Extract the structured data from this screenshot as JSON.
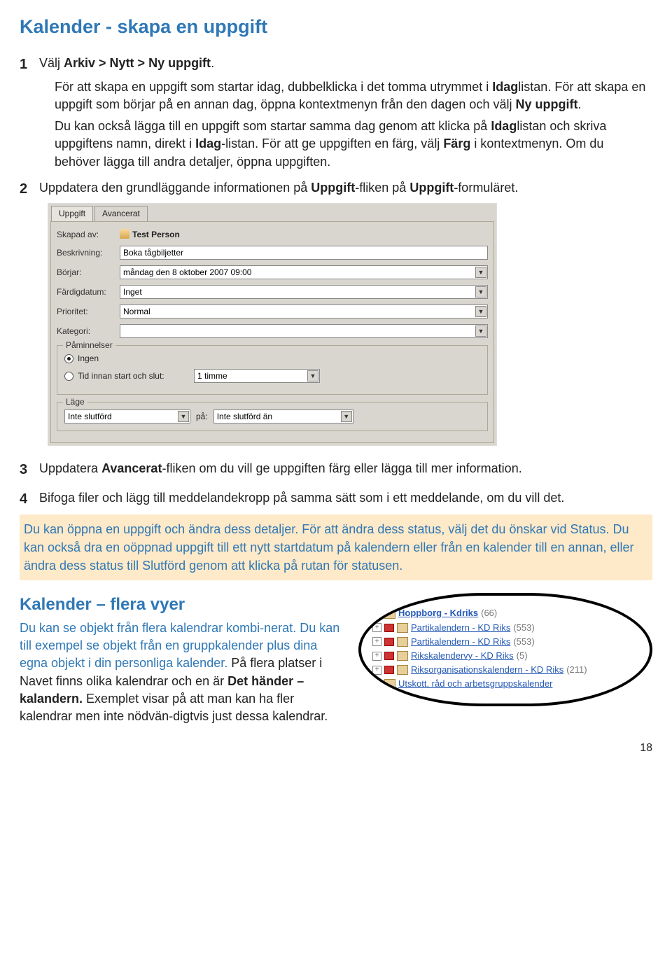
{
  "title": "Kalender - skapa en uppgift",
  "step1": {
    "num": "1",
    "lead": "Välj ",
    "bold": "Arkiv > Nytt > Ny uppgift",
    "tail": ".",
    "p1a": "För att skapa en uppgift som startar idag, dubbelklicka i det tomma utrymmet i ",
    "p1b": "Idag",
    "p1c": "listan. För att skapa en uppgift som börjar på en annan dag, öppna kontextmenyn från den dagen och välj ",
    "p1d": "Ny uppgift",
    "p1e": ".",
    "p2a": "Du kan också lägga till en uppgift som startar samma dag genom att klicka på ",
    "p2b": "Idag",
    "p2c": "listan och skriva uppgiftens namn, direkt i ",
    "p2d": "Idag",
    "p2e": "-listan. För att ge uppgiften en färg, välj ",
    "p2f": "Färg",
    "p2g": " i kontextmenyn. Om du behöver lägga till andra detaljer, öppna uppgiften."
  },
  "step2": {
    "num": "2",
    "a": "Uppdatera den grundläggande informationen på ",
    "b": "Uppgift",
    "c": "-fliken på ",
    "d": "Uppgift",
    "e": "-formuläret."
  },
  "form": {
    "tab_uppgift": "Uppgift",
    "tab_avancerat": "Avancerat",
    "skapad_label": "Skapad av:",
    "skapad_value": "Test Person",
    "beskrivning_label": "Beskrivning:",
    "beskrivning_value": "Boka tågbiljetter",
    "borjar_label": "Börjar:",
    "borjar_value": "måndag den 8 oktober 2007 09:00",
    "fardig_label": "Färdigdatum:",
    "fardig_value": "Inget",
    "prioritet_label": "Prioritet:",
    "prioritet_value": "Normal",
    "kategori_label": "Kategori:",
    "kategori_value": "",
    "paminnelser": "Påminnelser",
    "ingen": "Ingen",
    "tid_innan": "Tid innan start och slut:",
    "tid_innan_value": "1 timme",
    "lage": "Läge",
    "lage_value": "Inte slutförd",
    "pa_label": "på:",
    "pa_value": "Inte slutförd än"
  },
  "step3": {
    "num": "3",
    "a": "Uppdatera ",
    "b": "Avancerat",
    "c": "-fliken om du vill ge uppgiften färg eller lägga till mer information."
  },
  "step4": {
    "num": "4",
    "a": "Bifoga filer och lägg till meddelandekropp på samma sätt som i ett meddelande, om du vill det."
  },
  "hint": "Du kan öppna en uppgift och ändra dess detaljer. För att ändra dess status, välj det du önskar vid Status. Du kan också dra en oöppnad uppgift till ett nytt startdatum på kalendern eller från en kalender till en annan, eller ändra dess status till Slutförd genom att klicka på rutan för statusen.",
  "section2": {
    "title": "Kalender – flera vyer",
    "a": "Du kan se objekt från flera kalendrar kombi-nerat. Du kan till exempel se objekt från en gruppkalender plus dina egna objekt i din personliga kalender.",
    "b": " På flera platser i Navet finns olika kalendrar och en är ",
    "c": "Det händer – kalandern.",
    "d": " Exemplet visar på att man kan ha fler kalendrar men inte nödvän-digtvis just dessa kalendrar."
  },
  "tree": {
    "r1_name": "Hoppborg - Kdriks",
    "r1_count": "(66)",
    "r2_name": "Partikalendern - KD Riks",
    "r2_count": "(553)",
    "r3_name": "Partikalendern - KD Riks",
    "r3_count": "(553)",
    "r4_name": "Rikskalendervy - KD Riks",
    "r4_count": "(5)",
    "r5_name": "Riksorganisationskalendern - KD Riks",
    "r5_count": "(211)",
    "r6_name": "Utskott, råd och arbetsgruppskalender"
  },
  "page": "18"
}
